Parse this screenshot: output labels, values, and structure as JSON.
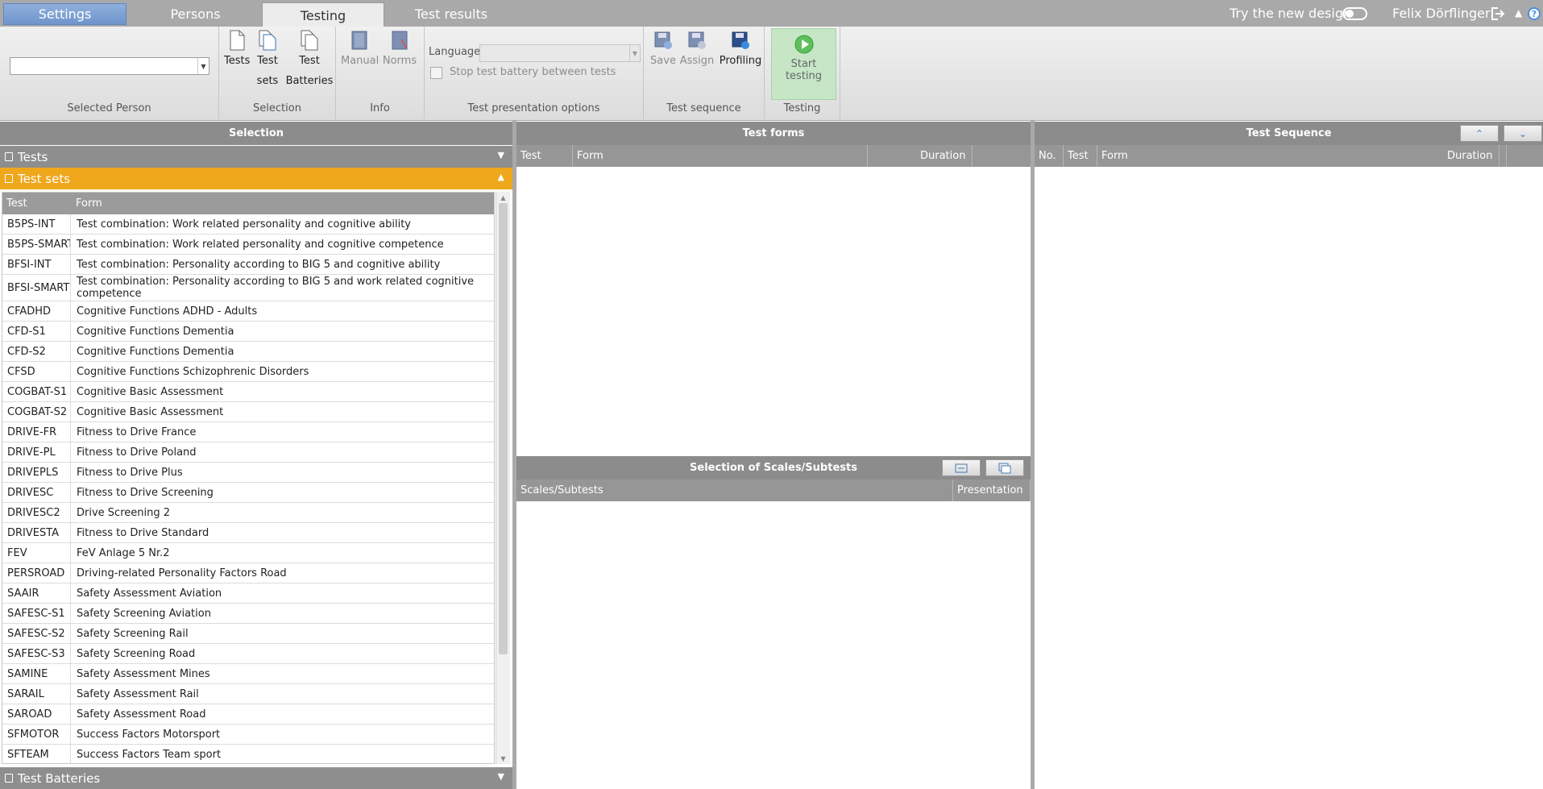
{
  "tabs": [
    {
      "label": "Settings"
    },
    {
      "label": "Persons"
    },
    {
      "label": "Testing"
    },
    {
      "label": "Test results"
    }
  ],
  "header": {
    "try_new_design": "Try the new design",
    "user_name": "Felix Dörflinger",
    "help": "?"
  },
  "ribbon": {
    "selected_person_label": "Selected Person",
    "selection_label": "Selection",
    "tests_btn": "Tests",
    "test_sets_btn_1": "Test",
    "test_sets_btn_2": "sets",
    "test_batteries_btn_1": "Test",
    "test_batteries_btn_2": "Batteries",
    "info_label": "Info",
    "manual_btn": "Manual",
    "norms_btn": "Norms",
    "language_label": "Language",
    "stop_battery_label": "Stop test battery between tests",
    "presentation_options_label": "Test presentation options",
    "save_btn": "Save",
    "assign_btn": "Assign",
    "profiling_btn": "Profiling",
    "test_sequence_label": "Test sequence",
    "start_testing_btn": "Start testing",
    "testing_label": "Testing"
  },
  "selection_panel": {
    "title": "Selection",
    "tests_section": "Tests",
    "test_sets_section": "Test sets",
    "test_batteries_section": "Test Batteries",
    "columns": [
      "Test",
      "Form"
    ],
    "rows": [
      {
        "test": "B5PS-INT",
        "form": "Test combination: Work related personality and cognitive ability"
      },
      {
        "test": "B5PS-SMART",
        "form": "Test combination: Work related personality and cognitive competence"
      },
      {
        "test": "BFSI-INT",
        "form": "Test combination: Personality according to BIG 5 and cognitive ability"
      },
      {
        "test": "BFSI-SMART",
        "form": "Test combination: Personality according to BIG 5 and work related cognitive competence"
      },
      {
        "test": "CFADHD",
        "form": "Cognitive Functions ADHD - Adults"
      },
      {
        "test": "CFD-S1",
        "form": "Cognitive Functions Dementia"
      },
      {
        "test": "CFD-S2",
        "form": "Cognitive Functions Dementia"
      },
      {
        "test": "CFSD",
        "form": "Cognitive Functions Schizophrenic Disorders"
      },
      {
        "test": "COGBAT-S1",
        "form": "Cognitive Basic Assessment"
      },
      {
        "test": "COGBAT-S2",
        "form": "Cognitive Basic Assessment"
      },
      {
        "test": "DRIVE-FR",
        "form": "Fitness to Drive France"
      },
      {
        "test": "DRIVE-PL",
        "form": "Fitness to Drive Poland"
      },
      {
        "test": "DRIVEPLS",
        "form": "Fitness to Drive Plus"
      },
      {
        "test": "DRIVESC",
        "form": "Fitness to Drive Screening"
      },
      {
        "test": "DRIVESC2",
        "form": "Drive Screening 2"
      },
      {
        "test": "DRIVESTA",
        "form": "Fitness to Drive Standard"
      },
      {
        "test": "FEV",
        "form": "FeV Anlage 5 Nr.2"
      },
      {
        "test": "PERSROAD",
        "form": "Driving-related Personality Factors Road"
      },
      {
        "test": "SAAIR",
        "form": "Safety Assessment Aviation"
      },
      {
        "test": "SAFESC-S1",
        "form": "Safety Screening Aviation"
      },
      {
        "test": "SAFESC-S2",
        "form": "Safety Screening Rail"
      },
      {
        "test": "SAFESC-S3",
        "form": "Safety Screening Road"
      },
      {
        "test": "SAMINE",
        "form": "Safety Assessment Mines"
      },
      {
        "test": "SARAIL",
        "form": "Safety Assessment Rail"
      },
      {
        "test": "SAROAD",
        "form": "Safety Assessment Road"
      },
      {
        "test": "SFMOTOR",
        "form": "Success Factors Motorsport"
      },
      {
        "test": "SFTEAM",
        "form": "Success Factors Team sport"
      }
    ]
  },
  "test_forms_panel": {
    "title": "Test forms",
    "columns": [
      "Test",
      "Form",
      "Duration"
    ],
    "scales_title": "Selection of Scales/Subtests",
    "scales_columns": [
      "Scales/Subtests",
      "Presentation"
    ]
  },
  "test_sequence_panel": {
    "title": "Test Sequence",
    "columns": [
      "No.",
      "Test",
      "Form",
      "Duration"
    ]
  },
  "colors": {
    "accent_orange": "#efa71c",
    "start_green": "#c6e6c6",
    "settings_blue": "#6f95cc"
  }
}
